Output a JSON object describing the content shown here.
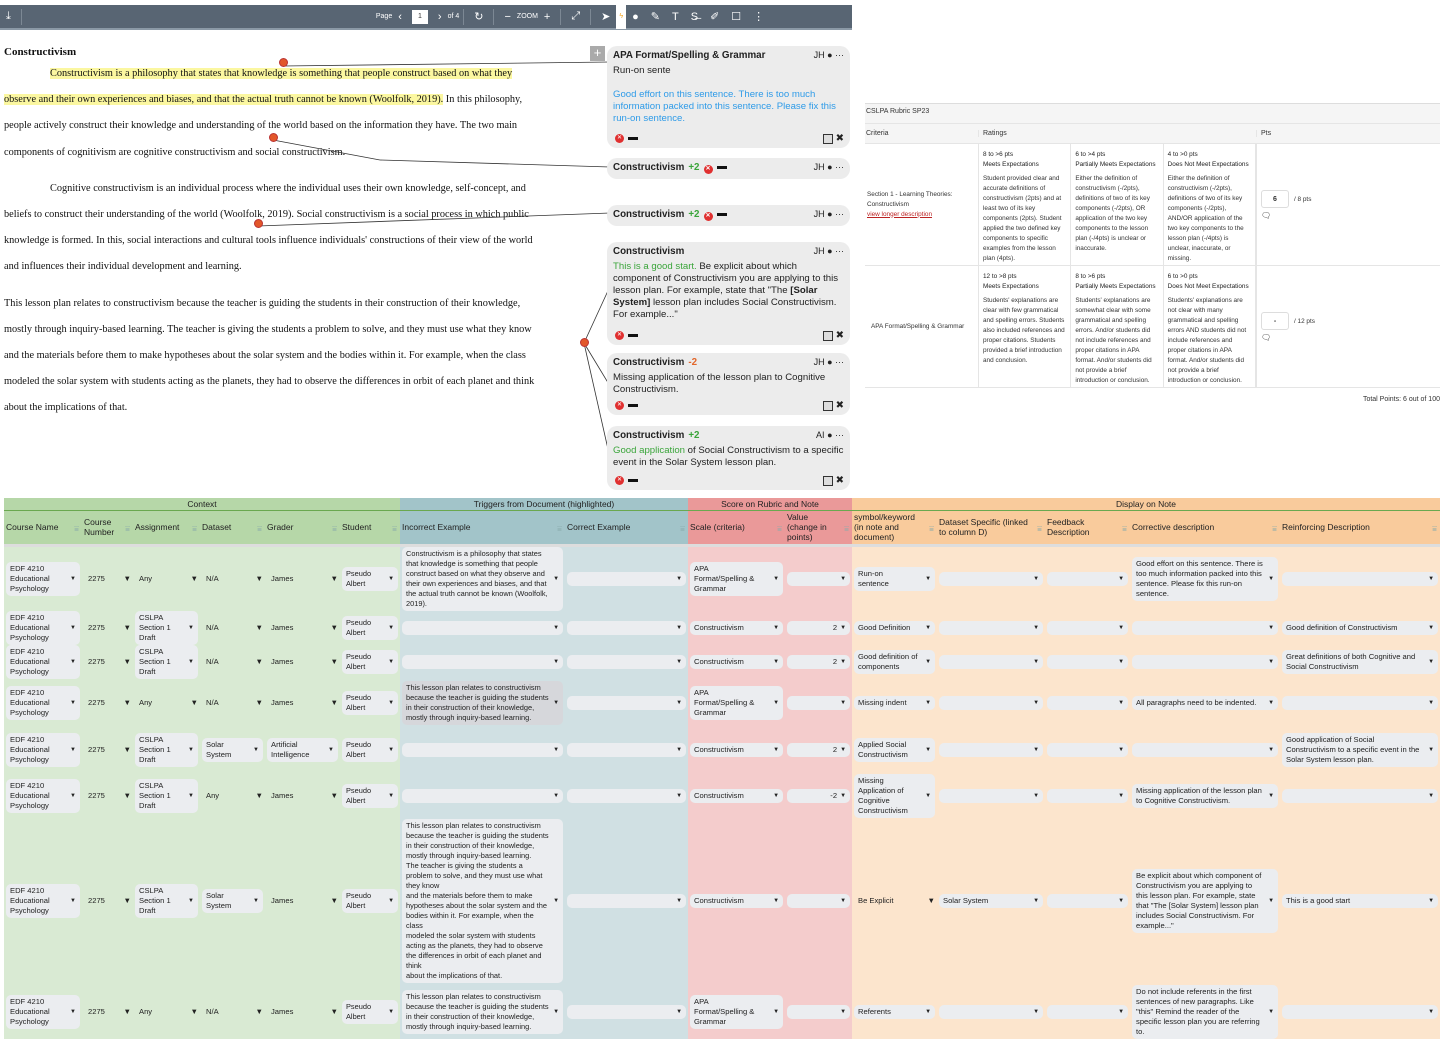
{
  "toolbar": {
    "page_label": "Page",
    "page": "1",
    "of": "of 4",
    "zoom_label": "ZOOM"
  },
  "doc": {
    "title": "Constructivism",
    "lines": [
      [
        {
          "t": "Constructivism is a philosophy that states that knowledge is something that people construct based on what they",
          "hl": true,
          "indent": true
        }
      ],
      [
        {
          "t": "observe and their own experiences and biases, and that the actual truth cannot be known (Woolfolk, 2019).",
          "hl": true
        },
        {
          "t": " In this philosophy,"
        }
      ],
      [
        {
          "t": "people actively construct their knowledge and understanding of the world based on the information they have. The two main"
        }
      ],
      [
        {
          "t": "components of cognitivism are cognitive constructivism and social constructivism."
        }
      ],
      [
        {
          "t": "Cognitive constructivism is an individual process where the individual uses their own knowledge, self-concept, and",
          "indent": true
        }
      ],
      [
        {
          "t": "beliefs to construct their understanding of the world (Woolfolk, 2019). Social constructivism is a social process in which public"
        }
      ],
      [
        {
          "t": "knowledge is formed. In this, social interactions and cultural tools influence individuals' constructions of their view of the world"
        }
      ],
      [
        {
          "t": "and influences their individual development and learning."
        }
      ],
      [
        {
          "t": "This lesson plan relates to constructivism because the teacher is guiding the students in their construction of their knowledge,"
        }
      ],
      [
        {
          "t": "mostly through inquiry-based learning. The teacher is giving the students a problem to solve, and they must use what they know"
        }
      ],
      [
        {
          "t": "and the materials before them to make hypotheses about the solar system and the bodies within it. For example, when the class"
        }
      ],
      [
        {
          "t": "modeled the solar system with students acting as the planets, they had to observe the differences in orbit of each planet and think"
        }
      ],
      [
        {
          "t": "about the implications of that."
        }
      ]
    ]
  },
  "comments": [
    {
      "title": "APA Format/Spelling & Grammar",
      "who": "JH",
      "quote": "Run-on sente",
      "segs": [
        {
          "t": "Good effort on this sentence. There is too much information packed into this sentence. Please fix this run-on sentence.",
          "c": "blue"
        }
      ]
    },
    {
      "title": "Constructivism",
      "score": "+2",
      "who": "JH"
    },
    {
      "title": "Constructivism",
      "score": "+2",
      "who": "JH"
    },
    {
      "title": "Constructivism",
      "who": "JH",
      "segs": [
        {
          "t": "This is a good start.",
          "c": "green"
        },
        {
          "t": " Be explicit about which component of Constructivism you are applying to this lesson plan. For example, state that \"The "
        },
        {
          "t": "[Solar System]",
          "b": true
        },
        {
          "t": " lesson plan includes Social Constructivism. For example...\""
        }
      ]
    },
    {
      "title": "Constructivism",
      "score": "-2",
      "who": "JH",
      "segs": [
        {
          "t": "Missing application of the lesson plan to Cognitive Constructivism."
        }
      ]
    },
    {
      "title": "Constructivism",
      "score": "+2",
      "who": "AI",
      "segs": [
        {
          "t": "Good application",
          "c": "green"
        },
        {
          "t": " of Social Constructivism to a specific event in the Solar System lesson plan."
        }
      ]
    }
  ],
  "rubric": {
    "title": "CSLPA Rubric SP23",
    "headers": {
      "criteria": "Criteria",
      "ratings": "Ratings",
      "pts": "Pts"
    },
    "rows": [
      {
        "criteria": "Section 1 - Learning Theories: Constructivism",
        "link": "view longer description",
        "score": "6",
        "max": "/ 8 pts",
        "ratings": [
          {
            "range": "8 to >6 pts",
            "label": "Meets Expectations",
            "desc": "Student provided clear and accurate definitions of constructivism (2pts) and at least two of its key components (2pts). Student applied the two defined key components to specific examples from the lesson plan (4pts)."
          },
          {
            "range": "6 to >4 pts",
            "label": "Partially Meets Expectations",
            "desc": "Either the definition of constructivism (-/2pts), definitions of two of its key components (-/2pts), OR application of the two key components to the lesson plan (-/4pts) is unclear or inaccurate."
          },
          {
            "range": "4 to >0 pts",
            "label": "Does Not Meet Expectations",
            "desc": "Either the definition of constructivism (-/2pts), definitions of two of its key components (-/2pts), AND/OR application of the two key components to the lesson plan (-/4pts) is unclear, inaccurate, or missing."
          }
        ]
      },
      {
        "criteria": "APA Format/Spelling & Grammar",
        "score": "-",
        "max": "/ 12 pts",
        "ratings": [
          {
            "range": "12 to >8 pts",
            "label": "Meets Expectations",
            "desc": "Students' explanations are clear with few grammatical and spelling errors. Students also included references and proper citations. Students provided a brief introduction and conclusion."
          },
          {
            "range": "8 to >6 pts",
            "label": "Partially Meets Expectations",
            "desc": "Students' explanations are somewhat clear with some grammatical and spelling errors. And/or students did not include references and proper citations in APA format. And/or students did not provide a brief introduction or conclusion."
          },
          {
            "range": "6 to >0 pts",
            "label": "Does Not Meet Expectations",
            "desc": "Students' explanations are not clear with many grammatical and spelling errors AND students did not include references and proper citations in APA format. And/or students did not provide a brief introduction or conclusion."
          }
        ]
      }
    ],
    "total": "Total Points: 6 out of 100"
  },
  "sheet": {
    "groups": [
      {
        "label": "Context",
        "span": 6,
        "color": "#b6d7a8"
      },
      {
        "label": "Triggers from Document (highlighted)",
        "span": 2,
        "color": "#a2c4c9"
      },
      {
        "label": "Score on Rubric and Note",
        "span": 2,
        "color": "#ea9999"
      },
      {
        "label": "Display on Note",
        "span": 5,
        "color": "#f9cb9c"
      }
    ],
    "row_colors": [
      "#d9ead3",
      "#d9ead3",
      "#d9ead3",
      "#d9ead3",
      "#d9ead3",
      "#d9ead3",
      "#d0e0e3",
      "#d0e0e3",
      "#f4cccc",
      "#f4cccc",
      "#fce5cd",
      "#fce5cd",
      "#fce5cd",
      "#fce5cd",
      "#fce5cd"
    ],
    "columns": [
      "Course Name",
      "Course Number",
      "Assignment",
      "Dataset",
      "Grader",
      "Student",
      "Incorrect Example",
      "Correct Example",
      "Scale (criteria)",
      "Value (change in points)",
      "symbol/keyword (in note and document)",
      "Dataset Specific (linked to column D)",
      "Feedback Description",
      "Corrective description",
      "Reinforcing Description"
    ],
    "rows": [
      [
        "EDF 4210\nEducational\nPsychology",
        "2275",
        "Any",
        "N/A",
        "James",
        "Pseudo\nAlbert",
        "Constructivism is a philosophy that states that knowledge is something that people construct based on what they observe and their own experiences and biases, and that the actual truth cannot be known (Woolfolk, 2019).",
        "",
        "APA\nFormat/Spelling &\nGrammar",
        "",
        "Run-on\nsentence",
        "",
        "",
        "Good effort on this sentence. There is too much information packed into this sentence. Please fix this run-on sentence.",
        ""
      ],
      [
        "EDF 4210\nEducational\nPsychology",
        "2275",
        "CSLPA\nSection 1\nDraft",
        "N/A",
        "James",
        "Pseudo\nAlbert",
        "",
        "",
        "Constructivism",
        "2",
        "Good Definition",
        "",
        "",
        "",
        "Good definition of Constructivism"
      ],
      [
        "EDF 4210\nEducational\nPsychology",
        "2275",
        "CSLPA\nSection 1\nDraft",
        "N/A",
        "James",
        "Pseudo\nAlbert",
        "",
        "",
        "Constructivism",
        "2",
        "Good definition of components",
        "",
        "",
        "",
        "Great definitions of both Cognitive and Social Constructivism"
      ],
      [
        "EDF 4210\nEducational\nPsychology",
        "2275",
        "Any",
        "N/A",
        "James",
        "Pseudo\nAlbert",
        "This lesson plan relates to constructivism because the teacher is guiding the students in their construction of their knowledge,\nmostly through inquiry-based learning.",
        "",
        "APA\nFormat/Spelling &\nGrammar",
        "",
        "Missing indent",
        "",
        "",
        "All paragraphs need to be indented.",
        ""
      ],
      [
        "EDF 4210\nEducational\nPsychology",
        "2275",
        "CSLPA\nSection 1\nDraft",
        "Solar\nSystem",
        "Artificial\nIntelligence",
        "Pseudo\nAlbert",
        "",
        "",
        "Constructivism",
        "2",
        "Applied Social Constructivism",
        "",
        "",
        "",
        "Good application of Social Constructivism to a specific event in the Solar System lesson plan."
      ],
      [
        "EDF 4210\nEducational\nPsychology",
        "2275",
        "CSLPA\nSection 1\nDraft",
        "Any",
        "James",
        "Pseudo\nAlbert",
        "",
        "",
        "Constructivism",
        "-2",
        "Missing Application of Cognitive Constructivism",
        "",
        "",
        "Missing application of the lesson plan to Cognitive Constructivism.",
        ""
      ],
      [
        "EDF 4210\nEducational\nPsychology",
        "2275",
        "CSLPA\nSection 1\nDraft",
        "Solar\nSystem",
        "James",
        "Pseudo\nAlbert",
        "This lesson plan relates to constructivism because the teacher is guiding the students in their construction of their knowledge,\nmostly through inquiry-based learning.\nThe teacher is giving the students a problem to solve, and they must use what they know\nand the materials before them to make hypotheses about the solar system and the bodies within it. For example, when the class\nmodeled the solar system with students acting as the planets, they had to observe the differences in orbit of each planet and think\nabout the implications of that.",
        "",
        "Constructivism",
        "",
        "Be Explicit",
        "Solar System",
        "",
        "Be explicit about which component of Constructivism you are applying to this lesson plan. For example, state that \"The [Solar System] lesson plan includes Social Constructivism. For example...\"",
        "This is a good start"
      ],
      [
        "EDF 4210\nEducational\nPsychology",
        "2275",
        "Any",
        "N/A",
        "James",
        "Pseudo\nAlbert",
        "This lesson plan relates to constructivism because the teacher is guiding the students in their construction of their knowledge,\nmostly through inquiry-based learning.",
        "",
        "APA\nFormat/Spelling &\nGrammar",
        "",
        "Referents",
        "",
        "",
        "Do not include referents in the first sentences of new paragraphs. Like \"this\" Remind the reader of the specific lesson plan you are referring to.",
        ""
      ]
    ]
  }
}
